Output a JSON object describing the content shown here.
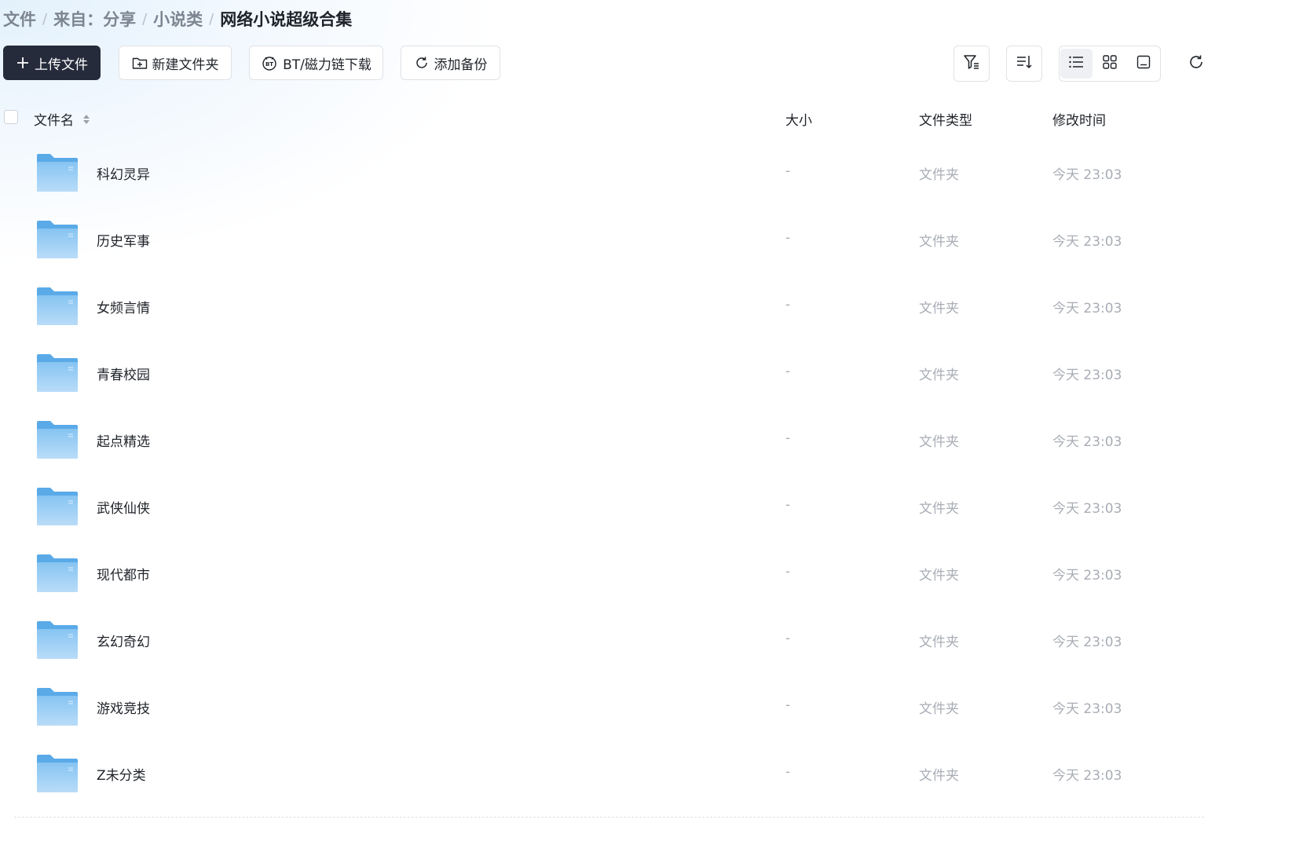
{
  "breadcrumb": [
    {
      "label": "文件"
    },
    {
      "label": "来自：分享"
    },
    {
      "label": "小说类"
    },
    {
      "label": "网络小说超级合集"
    }
  ],
  "breadcrumb_sep": "/",
  "toolbar": {
    "upload_label": "上传文件",
    "new_folder_label": "新建文件夹",
    "bt_label": "BT/磁力链下载",
    "backup_label": "添加备份"
  },
  "table": {
    "columns": {
      "name": "文件名",
      "size": "大小",
      "type": "文件类型",
      "modified": "修改时间"
    },
    "rows": [
      {
        "name": "科幻灵异",
        "size": "-",
        "type": "文件夹",
        "modified": "今天 23:03"
      },
      {
        "name": "历史军事",
        "size": "-",
        "type": "文件夹",
        "modified": "今天 23:03"
      },
      {
        "name": "女频言情",
        "size": "-",
        "type": "文件夹",
        "modified": "今天 23:03"
      },
      {
        "name": "青春校园",
        "size": "-",
        "type": "文件夹",
        "modified": "今天 23:03"
      },
      {
        "name": "起点精选",
        "size": "-",
        "type": "文件夹",
        "modified": "今天 23:03"
      },
      {
        "name": "武侠仙侠",
        "size": "-",
        "type": "文件夹",
        "modified": "今天 23:03"
      },
      {
        "name": "现代都市",
        "size": "-",
        "type": "文件夹",
        "modified": "今天 23:03"
      },
      {
        "name": "玄幻奇幻",
        "size": "-",
        "type": "文件夹",
        "modified": "今天 23:03"
      },
      {
        "name": "游戏竞技",
        "size": "-",
        "type": "文件夹",
        "modified": "今天 23:03"
      },
      {
        "name": "Z未分类",
        "size": "-",
        "type": "文件夹",
        "modified": "今天 23:03"
      }
    ]
  },
  "icons": {
    "upload": "plus-icon",
    "new_folder": "folder-plus-icon",
    "bt": "bt-icon",
    "backup": "refresh-backup-icon",
    "filter": "filter-icon",
    "sort": "sort-icon",
    "list_view": "list-view-icon",
    "grid_view": "grid-view-icon",
    "preview_view": "preview-view-icon",
    "refresh": "refresh-icon",
    "folder": "folder-icon"
  },
  "colors": {
    "primary": "#252b3b",
    "folder": "#6cb4ee",
    "muted_text": "#a8adb5"
  }
}
